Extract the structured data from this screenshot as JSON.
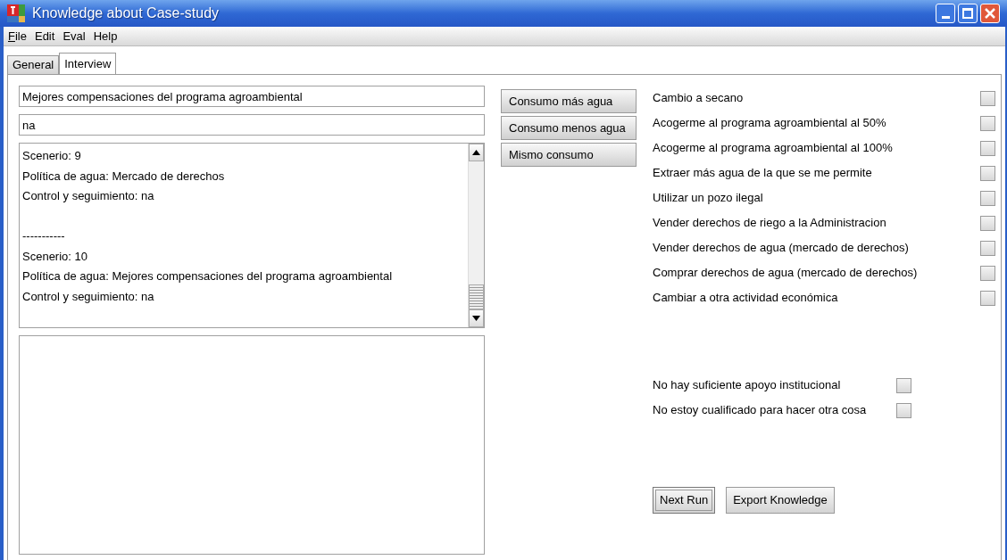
{
  "window": {
    "title": "Knowledge about Case-study"
  },
  "menu": [
    {
      "label": "File",
      "mnemonic": true
    },
    {
      "label": "Edit",
      "mnemonic": false
    },
    {
      "label": "Eval",
      "mnemonic": false
    },
    {
      "label": "Help",
      "mnemonic": false
    }
  ],
  "tabs": [
    {
      "label": "General",
      "selected": false
    },
    {
      "label": "Interview",
      "selected": true
    }
  ],
  "fields": [
    {
      "value": "Mejores compensaciones del programa agroambiental"
    },
    {
      "value": "na"
    }
  ],
  "log": {
    "blocks": [
      {
        "lines": [
          "Scenerio: 9",
          "Política de agua: Mercado de derechos",
          "Control y seguimiento: na"
        ]
      },
      {
        "lines": [
          "-----------",
          "Scenerio: 10",
          "Política de agua: Mejores compensaciones del programa agroambiental",
          "Control y seguimiento: na"
        ]
      }
    ]
  },
  "consumption_buttons": [
    "Consumo más agua",
    "Consumo menos agua",
    "Mismo consumo"
  ],
  "options": [
    {
      "label": "Cambio a secano",
      "checked": false
    },
    {
      "label": "Acogerme al programa agroambiental al 50%",
      "checked": false
    },
    {
      "label": "Acogerme al programa agroambiental al 100%",
      "checked": false
    },
    {
      "label": "Extraer más agua de la que se me permite",
      "checked": false
    },
    {
      "label": "Utilizar un pozo ilegal",
      "checked": false
    },
    {
      "label": "Vender derechos de riego a la Administracion",
      "checked": false
    },
    {
      "label": "Vender derechos de agua (mercado de derechos)",
      "checked": false
    },
    {
      "label": "Comprar derechos de agua (mercado de derechos)",
      "checked": false
    },
    {
      "label": "Cambiar a otra actividad económica",
      "checked": false
    }
  ],
  "reasons": [
    {
      "label": "No hay suficiente apoyo institucional",
      "checked": false
    },
    {
      "label": "No estoy cualificado para hacer otra cosa",
      "checked": false
    }
  ],
  "actions": [
    {
      "label": "Next Run",
      "focused": true
    },
    {
      "label": "Export Knowledge",
      "focused": false
    }
  ]
}
